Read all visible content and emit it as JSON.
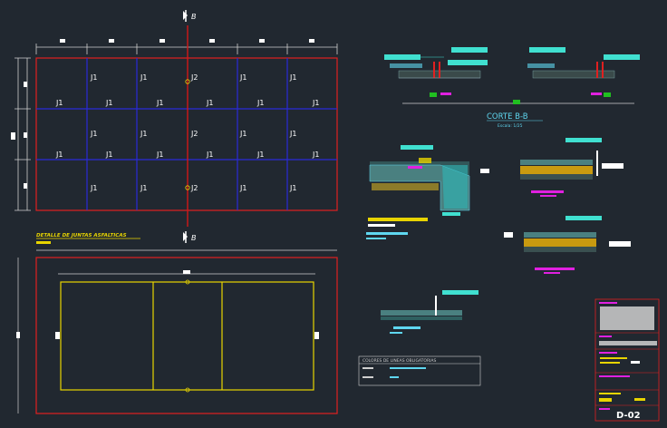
{
  "section_marker": "B",
  "joints": {
    "j1": "J1",
    "j2": "J2"
  },
  "headings": {
    "corte": "CORTE B-B",
    "escala": "Escala: 1/25",
    "detalle": "DETALLE DE JUNTAS ASFALTICAS",
    "colores": "COLORES DE LINEAS OBLIGATORIAS"
  },
  "title_block": {
    "sheet": "D-02"
  },
  "colors": {
    "background": "#212830",
    "grid_blue": "#2a2ad8",
    "border_red": "#e02020",
    "axis_red": "#d21818",
    "outline_yellow": "#e8d400",
    "annotation_cyan": "#5fd7f0",
    "magenta": "#e020e0",
    "green": "#20c020"
  }
}
